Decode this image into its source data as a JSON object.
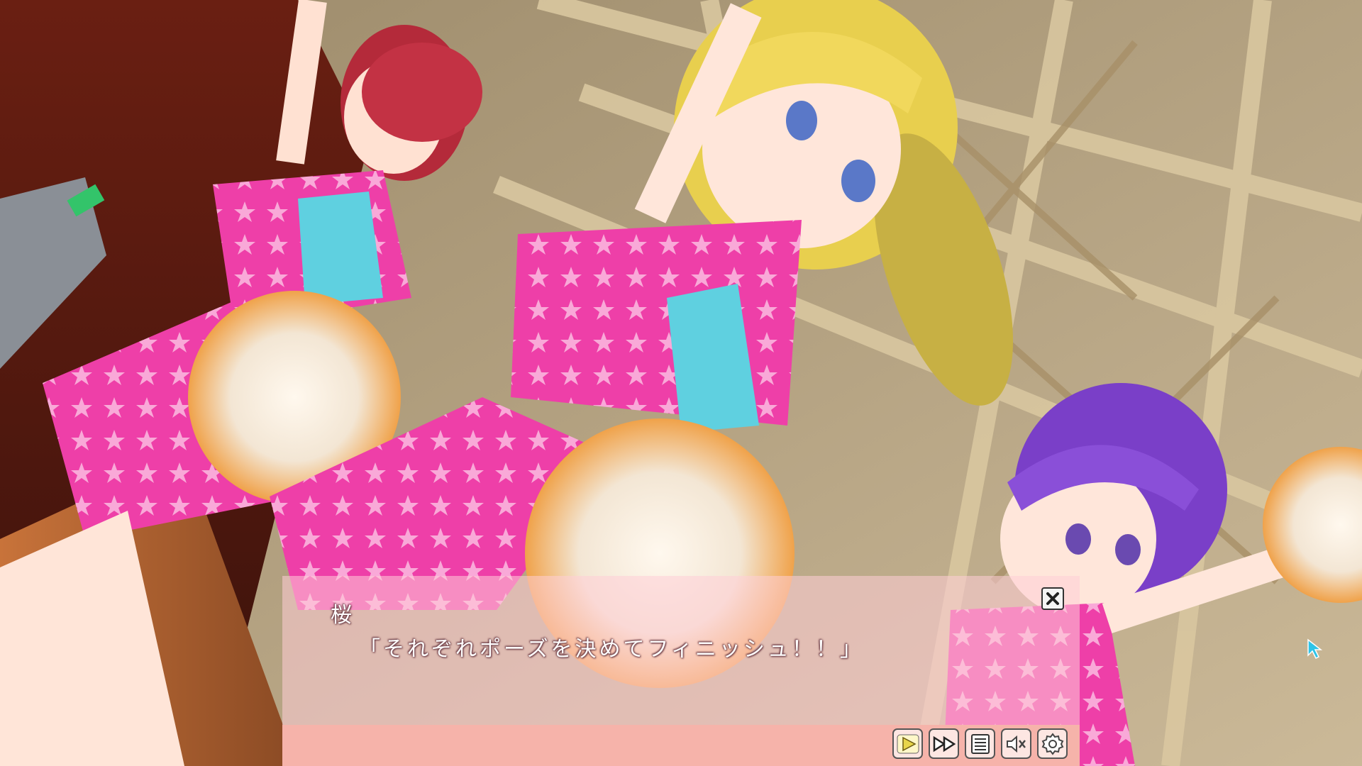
{
  "dialogue": {
    "speaker": "桜",
    "line": "「それぞれポーズを決めてフィニッシュ！！」"
  },
  "icons": {
    "close": "close-x-icon",
    "auto": "play-icon",
    "skip": "fast-forward-icon",
    "log": "backlog-list-icon",
    "voice": "mute-speaker-icon",
    "config": "gear-icon",
    "cursor": "mouse-pointer-icon"
  },
  "colors": {
    "dialog_bar": "#f6b3aa",
    "dialog_panel": "#ffcdd7",
    "button_face": "#fde6e2",
    "play_icon": "#e8d54a",
    "cursor": "#2ec4e8"
  }
}
